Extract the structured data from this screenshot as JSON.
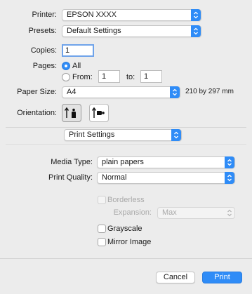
{
  "printer": {
    "label": "Printer:",
    "value": "EPSON XXXX"
  },
  "presets": {
    "label": "Presets:",
    "value": "Default Settings"
  },
  "copies": {
    "label": "Copies:",
    "value": "1"
  },
  "pages": {
    "label": "Pages:",
    "all_label": "All",
    "from_label": "From:",
    "from_value": "1",
    "to_label": "to:",
    "to_value": "1",
    "selected": "All"
  },
  "paper_size": {
    "label": "Paper Size:",
    "value": "A4",
    "dimensions": "210 by 297 mm"
  },
  "orientation": {
    "label": "Orientation:",
    "portrait_icon": "portrait-icon",
    "landscape_icon": "landscape-icon",
    "selected": "portrait"
  },
  "section_select": {
    "value": "Print Settings"
  },
  "media_type": {
    "label": "Media Type:",
    "value": "plain papers"
  },
  "print_quality": {
    "label": "Print Quality:",
    "value": "Normal"
  },
  "borderless": {
    "label": "Borderless",
    "checked": false,
    "enabled": false
  },
  "expansion": {
    "label": "Expansion:",
    "value": "Max",
    "enabled": false
  },
  "grayscale": {
    "label": "Grayscale",
    "checked": false
  },
  "mirror_image": {
    "label": "Mirror Image",
    "checked": false
  },
  "buttons": {
    "cancel": "Cancel",
    "print": "Print"
  },
  "colors": {
    "accent": "#2f8cf7",
    "background": "#ececec"
  }
}
